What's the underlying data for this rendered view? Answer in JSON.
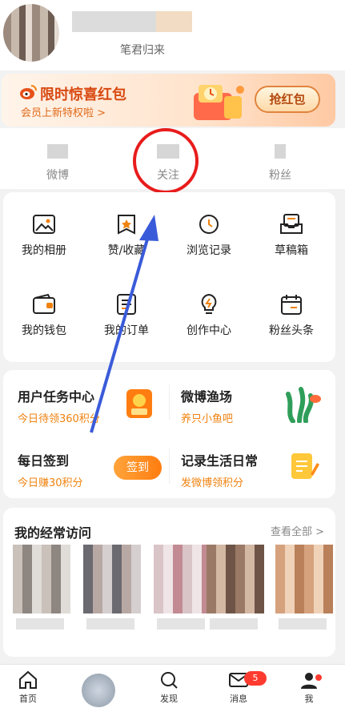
{
  "profile": {
    "bio": "笔君归来"
  },
  "banner": {
    "title": "限时惊喜红包",
    "subtitle": "会员上新特权啦 >",
    "button": "抢红包"
  },
  "stats": [
    {
      "label": "微博"
    },
    {
      "label": "关注"
    },
    {
      "label": "粉丝"
    }
  ],
  "grid": {
    "items": [
      {
        "label": "我的相册",
        "icon": "photo-album-icon"
      },
      {
        "label": "赞/收藏",
        "icon": "star-bookmark-icon"
      },
      {
        "label": "浏览记录",
        "icon": "history-clock-icon"
      },
      {
        "label": "草稿箱",
        "icon": "draft-box-icon"
      },
      {
        "label": "我的钱包",
        "icon": "wallet-icon"
      },
      {
        "label": "我的订单",
        "icon": "order-list-icon"
      },
      {
        "label": "创作中心",
        "icon": "lightbulb-icon"
      },
      {
        "label": "粉丝头条",
        "icon": "calendar-icon"
      }
    ]
  },
  "tasks": {
    "task_center": {
      "title": "用户任务中心",
      "sub": "今日待领360积分"
    },
    "fishery": {
      "title": "微博渔场",
      "sub": "养只小鱼吧"
    },
    "checkin": {
      "title": "每日签到",
      "sub": "今日赚30积分",
      "button": "签到"
    },
    "record": {
      "title": "记录生活日常",
      "sub": "发微博领积分"
    }
  },
  "visits": {
    "title": "我的经常访问",
    "view_all": "查看全部 >"
  },
  "tabbar": {
    "home": "首页",
    "discover": "发现",
    "messages": "消息",
    "me": "我",
    "message_badge": "5"
  },
  "colors": {
    "accent": "#f0820f",
    "annotation_red": "#e81c1c",
    "annotation_blue": "#3a5bd9"
  }
}
